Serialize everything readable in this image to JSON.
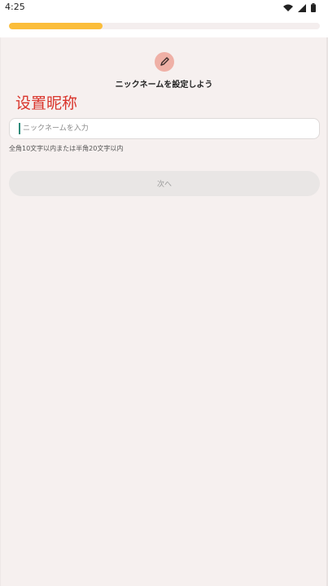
{
  "status_bar": {
    "time": "4:25",
    "icons": [
      "wifi-icon",
      "signal-icon",
      "battery-icon"
    ]
  },
  "progress": {
    "fraction": 0.3
  },
  "main": {
    "icon": "pencil-icon",
    "title": "ニックネームを設定しよう",
    "overlay_label": "设置昵称",
    "input": {
      "value": "",
      "placeholder": "ニックネームを入力"
    },
    "helper_text": "全角10文字以内または半角20文字以内",
    "next_button_label": "次へ"
  },
  "colors": {
    "progress": "#fbbd3a",
    "accent_badge": "#efb0a6",
    "overlay_label": "#d9342b",
    "background": "#f6f0ef"
  }
}
